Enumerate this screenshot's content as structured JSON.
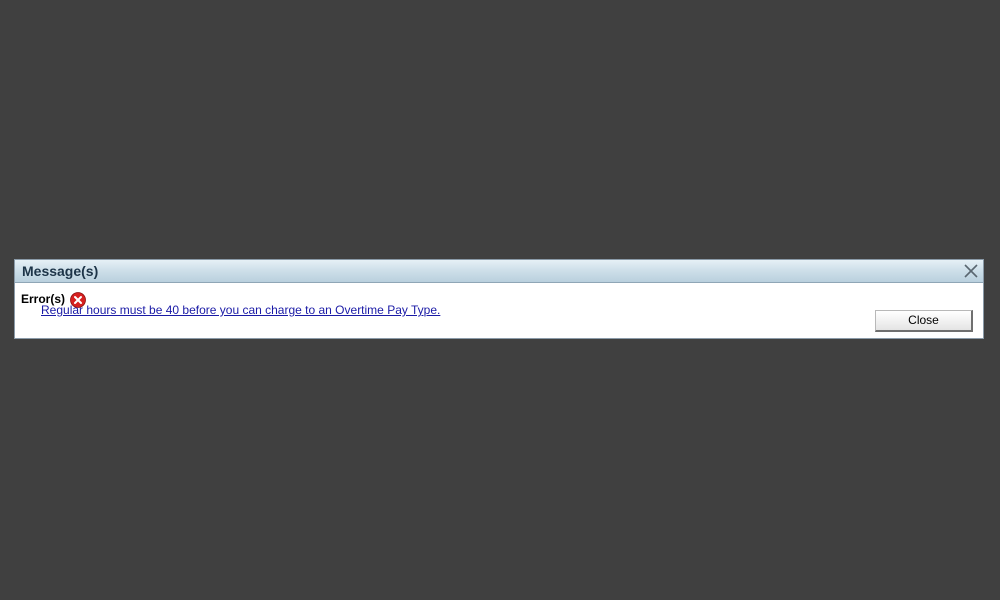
{
  "dialog": {
    "title": "Message(s)",
    "close_icon": "close-icon"
  },
  "errors": {
    "heading": "Error(s)",
    "icon": "error-icon",
    "icon_color": "#d62020",
    "items": [
      {
        "text": "Regular hours must be 40 before you can charge to an Overtime Pay Type."
      }
    ]
  },
  "buttons": {
    "close_label": "Close"
  },
  "colors": {
    "backdrop": "#404040",
    "title_text": "#1d3448",
    "link": "#1a1aa6"
  }
}
